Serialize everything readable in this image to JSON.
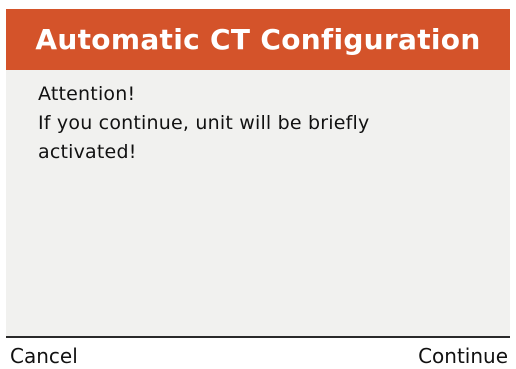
{
  "dialog": {
    "title": "Automatic CT Configuration",
    "message_lines": [
      "Attention!",
      "If you continue, unit will be briefly",
      "activated!"
    ]
  },
  "softkeys": {
    "left_label": "Cancel",
    "right_label": "Continue"
  },
  "colors": {
    "header_background": "#d4532a",
    "header_text": "#ffffff",
    "body_background": "#f1f1ef",
    "text": "#111111",
    "divider": "#2a2a2a"
  }
}
